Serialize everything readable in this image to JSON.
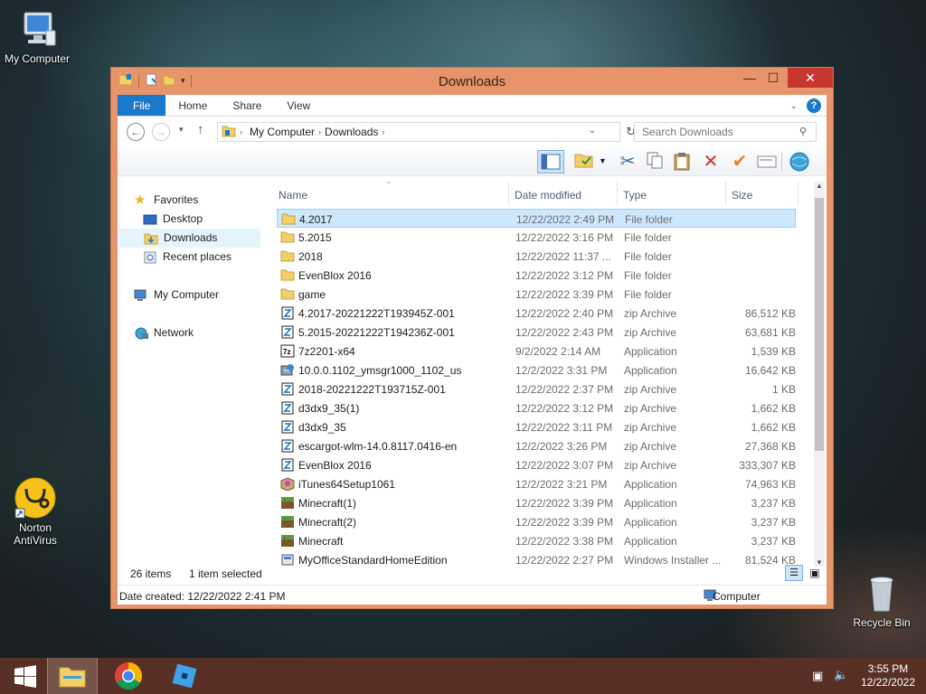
{
  "desktop": {
    "icons": {
      "my_computer": "My Computer",
      "norton": "Norton AntiVirus",
      "recycle_bin": "Recycle Bin"
    }
  },
  "window": {
    "title": "Downloads",
    "ribbon": {
      "file": "File",
      "home": "Home",
      "share": "Share",
      "view": "View",
      "help": "?"
    },
    "address": {
      "parts": [
        "My Computer",
        "Downloads"
      ]
    },
    "search": {
      "placeholder": "Search Downloads"
    },
    "nav": {
      "favorites": "Favorites",
      "desktop": "Desktop",
      "downloads": "Downloads",
      "recent": "Recent places",
      "my_computer": "My Computer",
      "network": "Network"
    },
    "columns": {
      "name": "Name",
      "date": "Date modified",
      "type": "Type",
      "size": "Size"
    },
    "files": [
      {
        "name": "4.2017",
        "date": "12/22/2022 2:49 PM",
        "type": "File folder",
        "size": "",
        "icon": "folder-icon",
        "selected": true
      },
      {
        "name": "5.2015",
        "date": "12/22/2022 3:16 PM",
        "type": "File folder",
        "size": "",
        "icon": "folder-icon"
      },
      {
        "name": "2018",
        "date": "12/22/2022 11:37 ...",
        "type": "File folder",
        "size": "",
        "icon": "folder-icon"
      },
      {
        "name": "EvenBlox 2016",
        "date": "12/22/2022 3:12 PM",
        "type": "File folder",
        "size": "",
        "icon": "folder-icon"
      },
      {
        "name": "game",
        "date": "12/22/2022 3:39 PM",
        "type": "File folder",
        "size": "",
        "icon": "folder-icon"
      },
      {
        "name": "4.2017-20221222T193945Z-001",
        "date": "12/22/2022 2:40 PM",
        "type": "zip Archive",
        "size": "86,512 KB",
        "icon": "zip-icon"
      },
      {
        "name": "5.2015-20221222T194236Z-001",
        "date": "12/22/2022 2:43 PM",
        "type": "zip Archive",
        "size": "63,681 KB",
        "icon": "zip-icon"
      },
      {
        "name": "7z2201-x64",
        "date": "9/2/2022 2:14 AM",
        "type": "Application",
        "size": "1,539 KB",
        "icon": "7zip-icon"
      },
      {
        "name": "10.0.0.1102_ymsgr1000_1102_us",
        "date": "12/2/2022 3:31 PM",
        "type": "Application",
        "size": "16,642 KB",
        "icon": "installer-icon"
      },
      {
        "name": "2018-20221222T193715Z-001",
        "date": "12/22/2022 2:37 PM",
        "type": "zip Archive",
        "size": "1 KB",
        "icon": "zip-icon"
      },
      {
        "name": "d3dx9_35(1)",
        "date": "12/22/2022 3:12 PM",
        "type": "zip Archive",
        "size": "1,662 KB",
        "icon": "zip-icon"
      },
      {
        "name": "d3dx9_35",
        "date": "12/22/2022 3:11 PM",
        "type": "zip Archive",
        "size": "1,662 KB",
        "icon": "zip-icon"
      },
      {
        "name": "escargot-wlm-14.0.8117.0416-en",
        "date": "12/2/2022 3:26 PM",
        "type": "zip Archive",
        "size": "27,368 KB",
        "icon": "zip-icon"
      },
      {
        "name": "EvenBlox 2016",
        "date": "12/22/2022 3:07 PM",
        "type": "zip Archive",
        "size": "333,307 KB",
        "icon": "zip-icon"
      },
      {
        "name": "iTunes64Setup1061",
        "date": "12/2/2022 3:21 PM",
        "type": "Application",
        "size": "74,963 KB",
        "icon": "itunes-icon"
      },
      {
        "name": "Minecraft(1)",
        "date": "12/22/2022 3:39 PM",
        "type": "Application",
        "size": "3,237 KB",
        "icon": "minecraft-icon"
      },
      {
        "name": "Minecraft(2)",
        "date": "12/22/2022 3:39 PM",
        "type": "Application",
        "size": "3,237 KB",
        "icon": "minecraft-icon"
      },
      {
        "name": "Minecraft",
        "date": "12/22/2022 3:38 PM",
        "type": "Application",
        "size": "3,237 KB",
        "icon": "minecraft-icon"
      },
      {
        "name": "MyOfficeStandardHomeEdition",
        "date": "12/22/2022 2:27 PM",
        "type": "Windows Installer ...",
        "size": "81,524 KB",
        "icon": "msi-icon"
      }
    ],
    "status": {
      "count": "26 items",
      "selected": "1 item selected"
    },
    "details": {
      "created": "Date created: 12/22/2022 2:41 PM",
      "location": "Computer"
    }
  },
  "taskbar": {
    "time": "3:55 PM",
    "date": "12/22/2022"
  },
  "colors": {
    "frame": "#e8946a",
    "accent": "#1979ca",
    "taskbar": "#5a3024"
  }
}
